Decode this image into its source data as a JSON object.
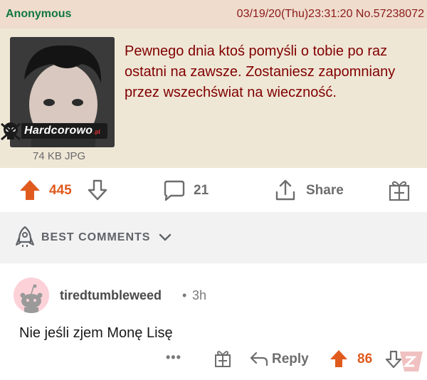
{
  "post": {
    "name": "Anonymous",
    "meta": "03/19/20(Thu)23:31:20 No.57238072",
    "text": "Pewnego dnia ktoś pomyśli o tobie po raz ostatni na zawsze. Zostaniesz zapomniany przez wszechświat na wieczność.",
    "file_info": "74 KB JPG",
    "watermark_text": "Hardcorowo",
    "watermark_suffix": ".pl"
  },
  "actions": {
    "upvotes": "445",
    "comments": "21",
    "share_label": "Share"
  },
  "sort": {
    "label": "BEST COMMENTS"
  },
  "comment": {
    "username": "tiredtumbleweed",
    "separator": "•",
    "time": "3h",
    "body": "Nie jeśli zjem Monę Lisę",
    "more": "•••",
    "reply_label": "Reply",
    "upvotes": "86"
  },
  "colors": {
    "upvote_orange": "#e05a1e",
    "greentext_name": "#117743",
    "post_maroon": "#800000"
  }
}
